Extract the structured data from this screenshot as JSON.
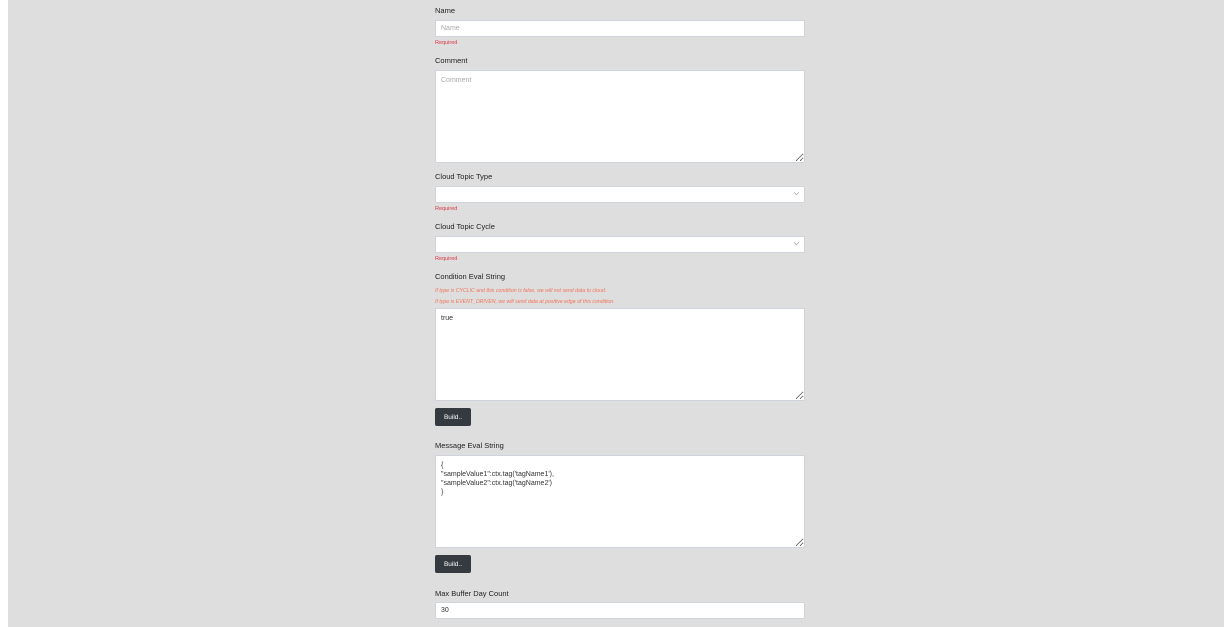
{
  "form": {
    "name": {
      "label": "Name",
      "placeholder": "Name",
      "value": "",
      "error": "Required"
    },
    "comment": {
      "label": "Comment",
      "placeholder": "Comment",
      "value": ""
    },
    "cloud_topic_type": {
      "label": "Cloud Topic Type",
      "selected": "",
      "error": "Required"
    },
    "cloud_topic_cycle": {
      "label": "Cloud Topic Cycle",
      "selected": "",
      "error": "Required"
    },
    "condition_eval": {
      "label": "Condition Eval String",
      "hints": [
        "If type is CYCLIC and this condition is false, we will not send data to cloud.",
        "If type is EVENT_DRIVEN, we will send data at positive edge of this condition."
      ],
      "value": "true",
      "build_label": "Build.."
    },
    "message_eval": {
      "label": "Message Eval String",
      "value": "{\n\"sampleValue1\":ctx.tag('tagName1'),\n\"sampleValue2\":ctx.tag('tagName2')\n}",
      "build_label": "Build.."
    },
    "max_buffer_day_count": {
      "label": "Max Buffer Day Count",
      "value": "30"
    }
  },
  "icons": {
    "select_arrow": "chevron-down-icon"
  }
}
